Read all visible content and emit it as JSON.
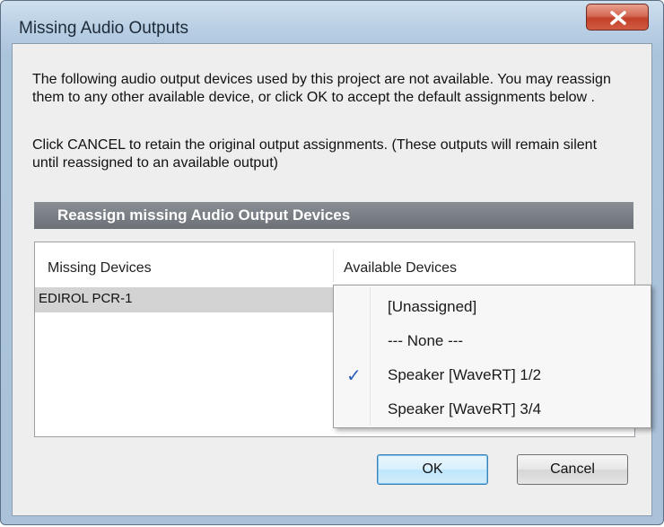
{
  "window": {
    "title": "Missing Audio Outputs",
    "close_icon": "close-icon"
  },
  "message": {
    "line1": "The following audio output devices used by this project are not available. You may reassign them to any other available device, or click OK to accept the default assignments below .",
    "line2": "Click CANCEL to retain the original output assignments. (These outputs will remain silent until reassigned to an available output)"
  },
  "section": {
    "title": "Reassign missing Audio Output Devices"
  },
  "table": {
    "columns": [
      "Missing Devices",
      "Available Devices"
    ],
    "rows": [
      {
        "missing": "EDIROL PCR-1",
        "available": "Speaker [WaveRT] 1/2"
      }
    ]
  },
  "dropdown": {
    "options": [
      "[Unassigned]",
      "--- None ---",
      "Speaker [WaveRT] 1/2",
      "Speaker [WaveRT] 3/4"
    ],
    "selected": "Speaker [WaveRT] 1/2",
    "check_mark": "✓"
  },
  "buttons": {
    "ok": "OK",
    "cancel": "Cancel"
  },
  "colors": {
    "section_bar": "#6c7178",
    "check_mark": "#2d5fb8",
    "close_button": "#c2412a"
  }
}
